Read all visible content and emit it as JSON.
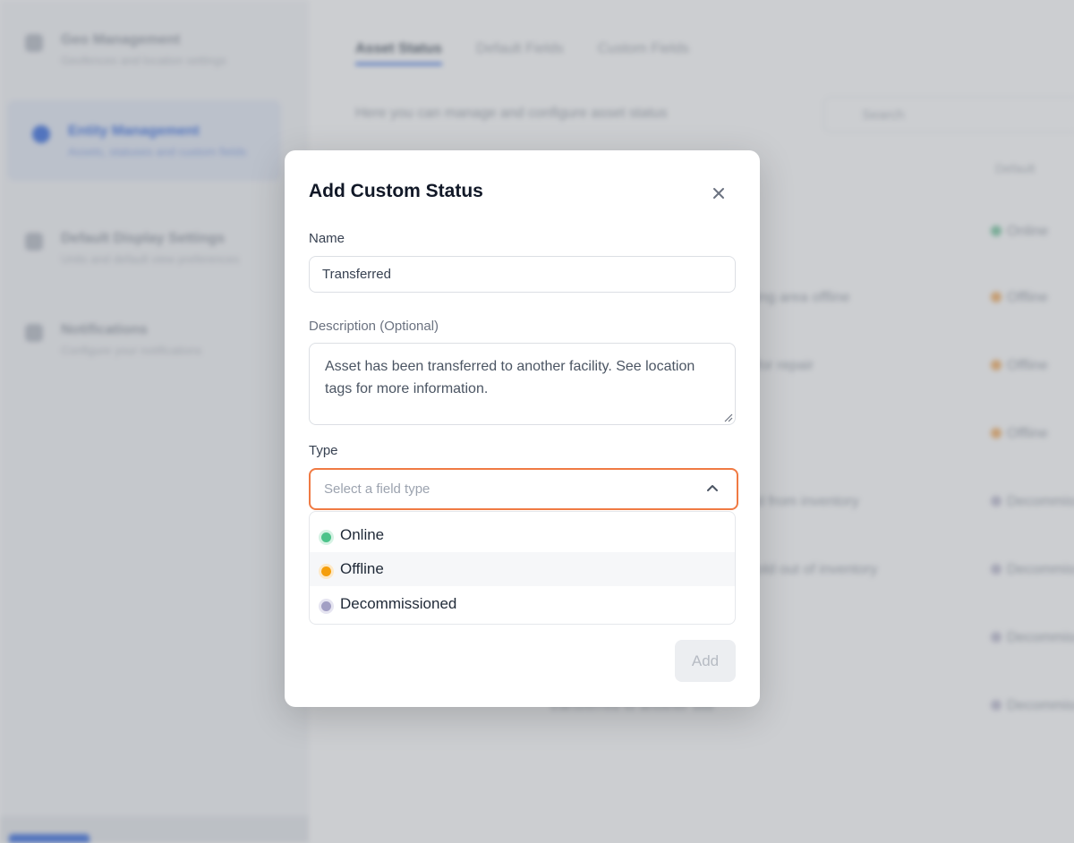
{
  "background": {
    "sidebar": {
      "items": [
        {
          "title": "Geo Management",
          "subtitle": "Geofences and location settings",
          "icon": "map-icon",
          "active": false
        },
        {
          "title": "Entity Management",
          "subtitle": "Assets, statuses and custom fields",
          "icon": "entity-icon",
          "active": true
        },
        {
          "title": "Default Display Settings",
          "subtitle": "Units and default view preferences",
          "icon": "display-icon",
          "active": false
        },
        {
          "title": "Notifications",
          "subtitle": "Configure your notifications",
          "icon": "bell-icon",
          "active": false
        }
      ]
    },
    "tabs": [
      "Asset Status",
      "Default Fields",
      "Custom Fields"
    ],
    "description": "Here you can manage and configure asset status",
    "search_placeholder": "Search",
    "column_header": "Default",
    "rows": [
      {
        "text": "",
        "status": "Online",
        "color": "#7cc9a3"
      },
      {
        "text": "ing area offline",
        "status": "Offline",
        "color": "#f4b26b"
      },
      {
        "text": "for repair",
        "status": "Offline",
        "color": "#f4b26b"
      },
      {
        "text": "",
        "status": "Offline",
        "color": "#f4b26b"
      },
      {
        "text": "d from inventory",
        "status": "Decommiss",
        "color": "#c2c0d3"
      },
      {
        "text": "old out of inventory",
        "status": "Decommiss",
        "color": "#c2c0d3"
      },
      {
        "text": "",
        "status": "Decommiss",
        "color": "#c2c0d3"
      },
      {
        "text": "transferred to another site",
        "status": "Decommiss",
        "color": "#c2c0d3"
      }
    ]
  },
  "modal": {
    "title": "Add Custom Status",
    "close_icon": "close-icon",
    "name_label": "Name",
    "name_value": "Transferred",
    "description_label": "Description (Optional)",
    "description_value": "Asset has been transferred to another facility. See location tags for more information.",
    "type_label": "Type",
    "type_placeholder": "Select a field type",
    "type_options": [
      {
        "label": "Online",
        "color": "#4cc38a"
      },
      {
        "label": "Offline",
        "color": "#f59e0b"
      },
      {
        "label": "Decommissioned",
        "color": "#a29fc4"
      }
    ],
    "hovered_option": "Offline",
    "add_label": "Add",
    "colors": {
      "focus_border": "#f07a43"
    }
  }
}
